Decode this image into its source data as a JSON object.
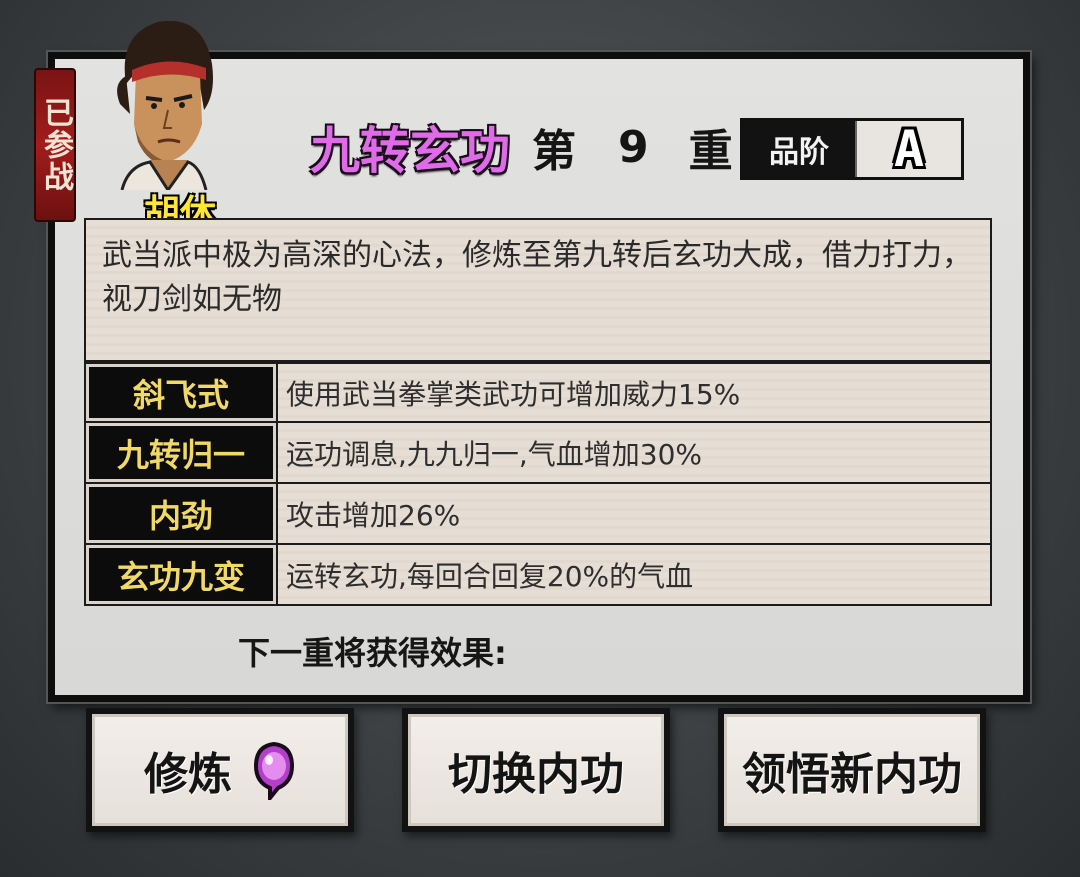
{
  "badge": {
    "text": "已参战"
  },
  "character": {
    "name": "胡休"
  },
  "skill": {
    "name": "九转玄功",
    "level_prefix": "第",
    "level": "9",
    "level_suffix": "重",
    "grade_label": "品阶",
    "grade": "A",
    "description": "武当派中极为高深的心法，修炼至第九转后玄功大成，借力打力，视刀剑如无物"
  },
  "effects": [
    {
      "name": "斜飞式",
      "desc": "使用武当拳掌类武功可增加威力15%"
    },
    {
      "name": "九转归一",
      "desc": "运功调息,九九归一,气血增加30%"
    },
    {
      "name": "内劲",
      "desc": "攻击增加26%"
    },
    {
      "name": "玄功九变",
      "desc": "运转玄功,每回合回复20%的气血"
    }
  ],
  "next_level_label": "下一重将获得效果:",
  "buttons": {
    "train": "修炼",
    "switch": "切换内功",
    "learn": "领悟新内功"
  },
  "colors": {
    "skill_title": "#e06be8",
    "char_name": "#ffe637",
    "effect_name": "#f1d968",
    "badge_bg": "#a31c1c"
  }
}
